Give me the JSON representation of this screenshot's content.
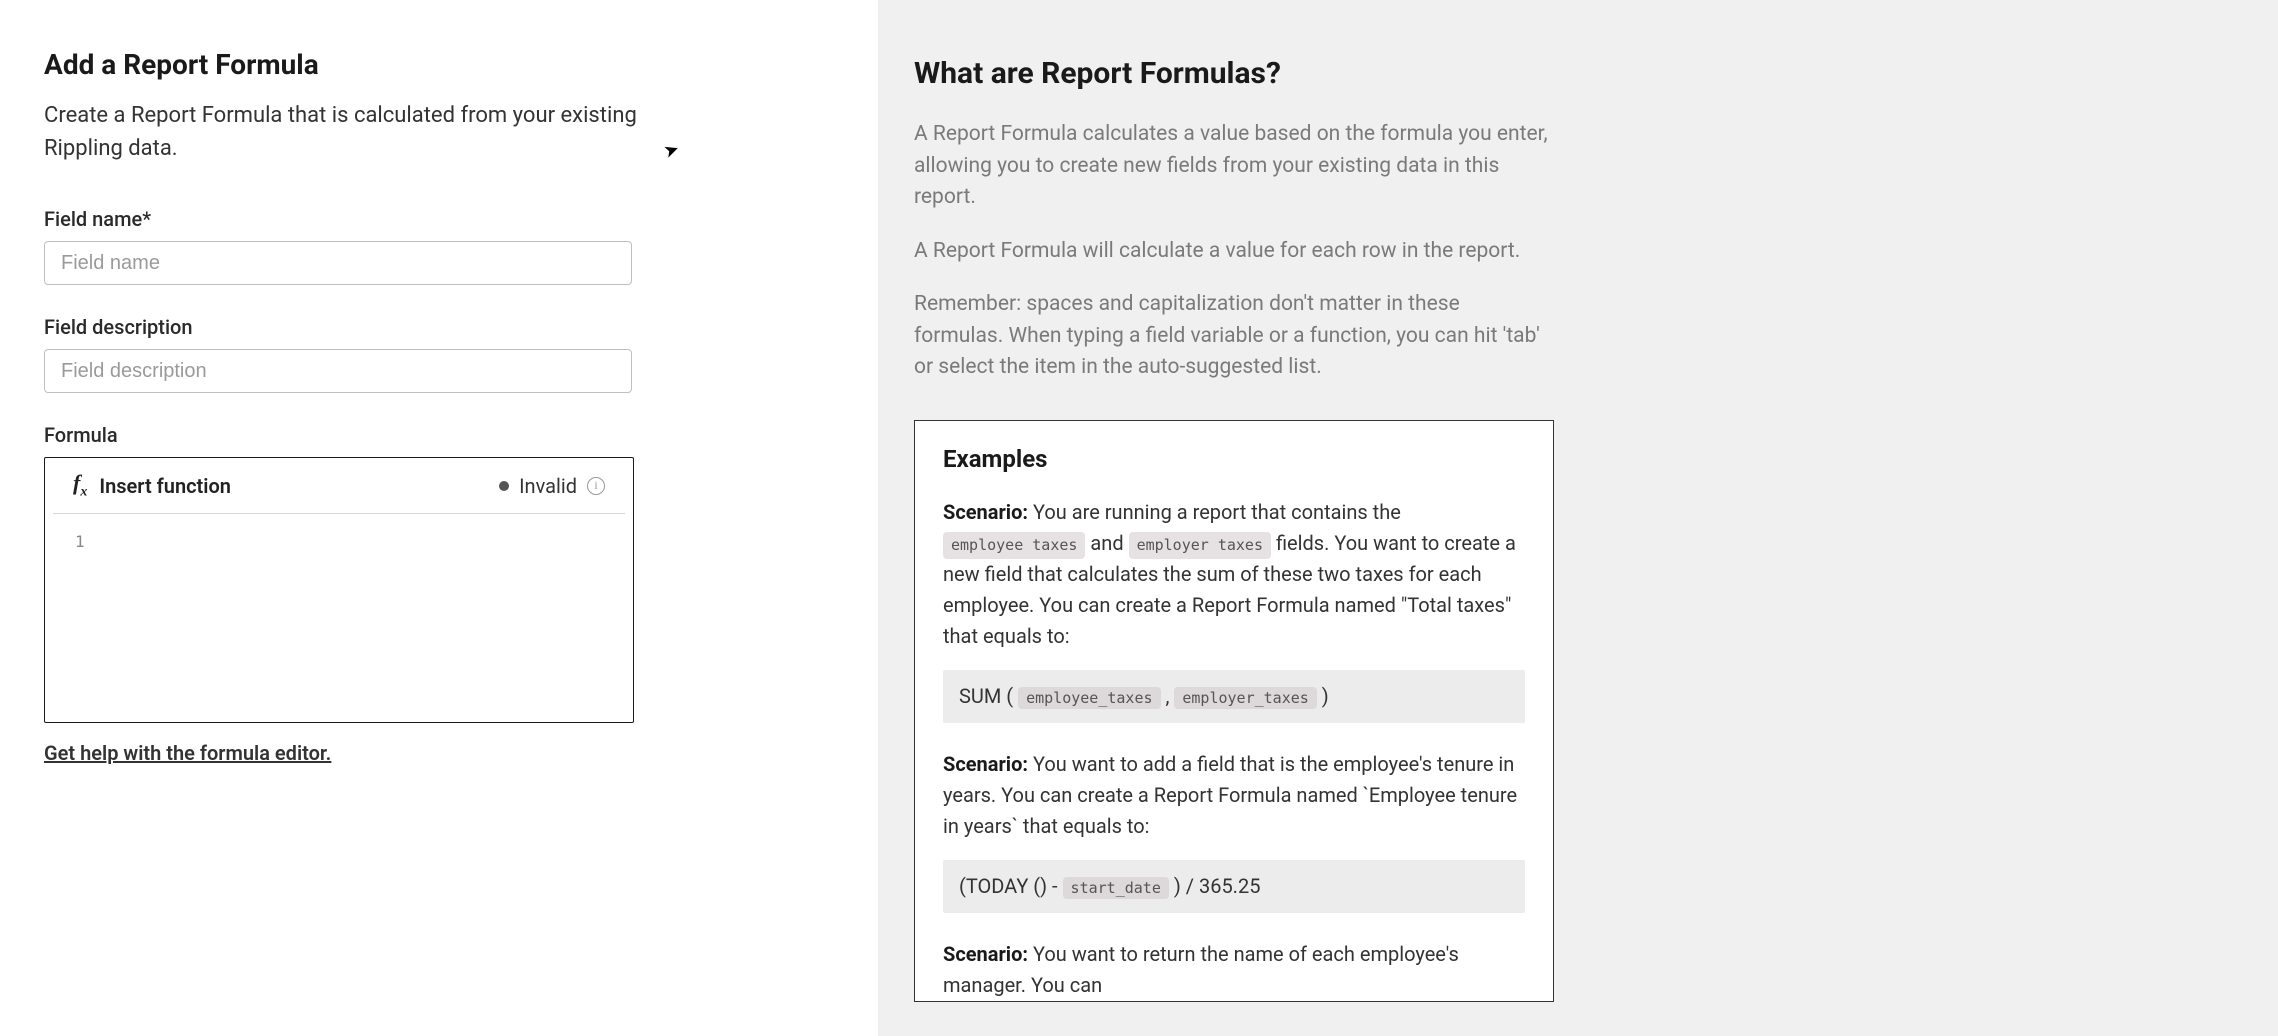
{
  "left": {
    "title": "Add a Report Formula",
    "subtitle": "Create a Report Formula that is calculated from your existing Rippling data.",
    "field_name_label": "Field name*",
    "field_name_placeholder": "Field name",
    "field_description_label": "Field description",
    "field_description_placeholder": "Field description",
    "formula_label": "Formula",
    "insert_function_label": "Insert function",
    "status_text": "Invalid",
    "line_number": "1",
    "help_link": "Get help with the formula editor."
  },
  "right": {
    "title": "What are Report Formulas?",
    "para1": "A Report Formula calculates a value based on the formula you enter, allowing you to create new fields from your existing data in this report.",
    "para2": "A Report Formula will calculate a value for each row in the report.",
    "para3": "Remember: spaces and capitalization don't matter in these formulas. When typing a field variable or a function, you can hit 'tab' or select the item in the auto-suggested list.",
    "examples": {
      "heading": "Examples",
      "scenario1": {
        "label": "Scenario:",
        "text_a": " You are running a report that contains the ",
        "pill_a": "employee taxes",
        "text_b": " and ",
        "pill_b": "employer taxes",
        "text_c": " fields. You want to create a new field that calculates the sum of these two taxes for each employee. You can create a Report Formula named \"Total taxes\" that equals to:"
      },
      "code1": {
        "pre": "SUM ( ",
        "pill_a": "employee_taxes",
        "mid": " , ",
        "pill_b": "employer_taxes",
        "post": " )"
      },
      "scenario2": {
        "label": "Scenario:",
        "text": " You want to add a field that is the employee's tenure in years. You can create a Report Formula named `Employee tenure in years` that equals to:"
      },
      "code2": {
        "pre": "(TODAY () - ",
        "pill": "start_date",
        "post": " ) / 365.25"
      },
      "scenario3": {
        "label": "Scenario:",
        "text": " You want to return the name of each employee's manager. You can"
      }
    }
  }
}
